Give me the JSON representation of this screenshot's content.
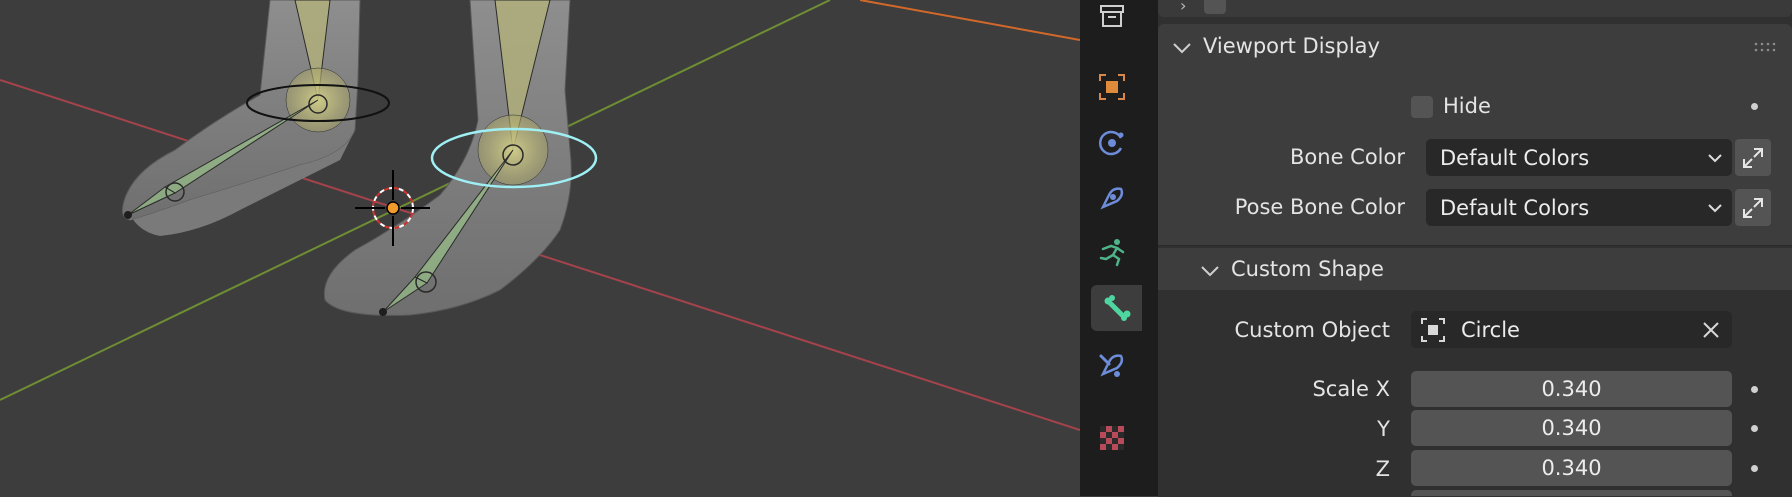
{
  "colors": {
    "viewport_bg": "#3d3d3d",
    "x_axis": "#a4434b",
    "y_axis": "#6f8e34",
    "accent_cyan": "#9ff0f5",
    "origin_orange": "#f39b2a",
    "tab_bar": "#1d1d1d",
    "panel_bg": "#3d3d3d",
    "field_bg": "#545454",
    "dropdown_bg": "#282828"
  },
  "tabs": [
    {
      "icon": "archive-icon"
    },
    {
      "icon": "object-icon"
    },
    {
      "icon": "physics-orbit-icon"
    },
    {
      "icon": "constraint-icon"
    },
    {
      "icon": "pose-running-icon"
    },
    {
      "icon": "bone-icon",
      "active": true
    },
    {
      "icon": "bone-constraint-icon"
    },
    {
      "icon": "texture-checker-icon"
    }
  ],
  "viewport_display": {
    "header": "Viewport Display",
    "hide_label": "Hide",
    "bone_color_label": "Bone Color",
    "bone_color_value": "Default Colors",
    "pose_bone_color_label": "Pose Bone Color",
    "pose_bone_color_value": "Default Colors"
  },
  "custom_shape": {
    "header": "Custom Shape",
    "object_label": "Custom Object",
    "object_value": "Circle",
    "scale_x_label": "Scale X",
    "scale_x_value": "0.340",
    "scale_y_label": "Y",
    "scale_y_value": "0.340",
    "scale_z_label": "Z",
    "scale_z_value": "0.340"
  }
}
